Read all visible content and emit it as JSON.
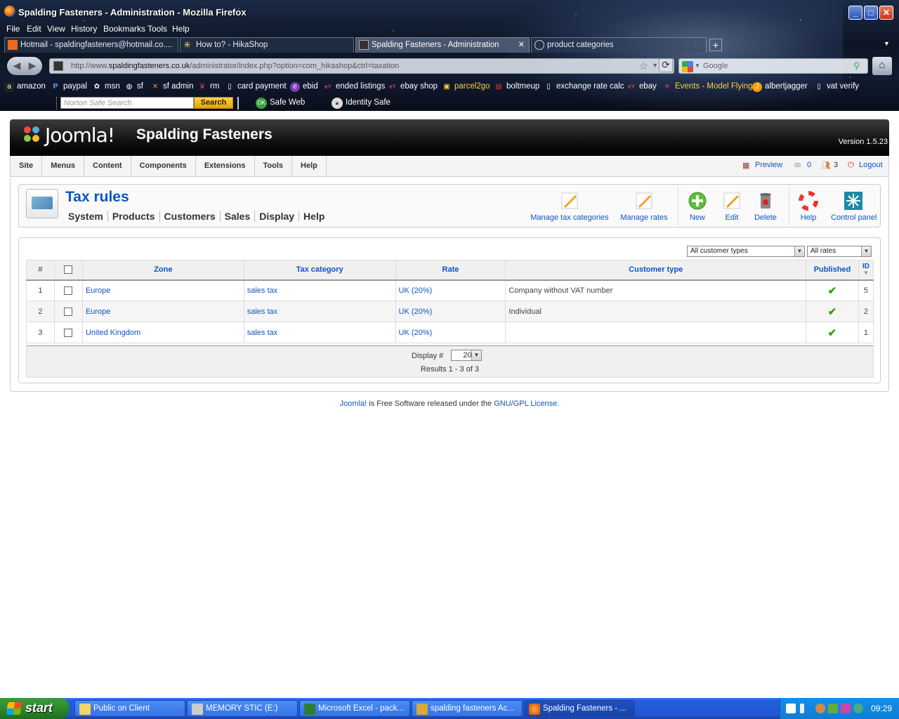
{
  "browser": {
    "window_title": "Spalding Fasteners - Administration - Mozilla Firefox",
    "menu": [
      "File",
      "Edit",
      "View",
      "History",
      "Bookmarks",
      "Tools",
      "Help"
    ],
    "tabs": [
      {
        "label": "Hotmail - spaldingfasteners@hotmail.co....",
        "active": false
      },
      {
        "label": "How to? - HikaShop",
        "active": false
      },
      {
        "label": "Spalding Fasteners - Administration",
        "active": true
      },
      {
        "label": "product categories",
        "active": false
      }
    ],
    "url_prefix": "http://www.",
    "url_domain": "spaldingfasteners.co.uk",
    "url_rest": "/administrator/index.php?option=com_hikashop&ctrl=taxation",
    "search_engine": "Google",
    "bookmarks": [
      "amazon",
      "paypal",
      "msn",
      "sf",
      "sf admin",
      "rm",
      "card payment",
      "ebid",
      "ended listings",
      "ebay shop",
      "parcel2go",
      "boltmeup",
      "exchange rate calc",
      "ebay",
      "Events - Model Flying",
      "albertjagger",
      "vat verify"
    ],
    "norton": {
      "search_placeholder": "Norton Safe Search",
      "search_button": "Search",
      "safe_web": "Safe Web",
      "identity_safe": "Identity Safe"
    }
  },
  "joomla": {
    "logo_text": "Joomla!",
    "site_name": "Spalding Fasteners",
    "version": "Version 1.5.23",
    "menu": [
      "Site",
      "Menus",
      "Content",
      "Components",
      "Extensions",
      "Tools",
      "Help"
    ],
    "status": {
      "preview": "Preview",
      "messages": "0",
      "users": "3",
      "logout": "Logout"
    },
    "page_title": "Tax rules",
    "submenu": [
      "System",
      "Products",
      "Customers",
      "Sales",
      "Display",
      "Help"
    ],
    "toolbar": {
      "manage_tax_categories": "Manage tax categories",
      "manage_rates": "Manage rates",
      "new": "New",
      "edit": "Edit",
      "delete": "Delete",
      "help": "Help",
      "control_panel": "Control panel"
    },
    "filters": {
      "customer_types": "All customer types",
      "rates": "All rates"
    },
    "table": {
      "headers": {
        "num": "#",
        "zone": "Zone",
        "tax_category": "Tax category",
        "rate": "Rate",
        "customer_type": "Customer type",
        "published": "Published",
        "id": "ID"
      },
      "rows": [
        {
          "num": "1",
          "zone": "Europe",
          "tax_category": "sales tax",
          "rate": "UK (20%)",
          "customer_type": "Company without VAT number",
          "published": true,
          "id": "5"
        },
        {
          "num": "2",
          "zone": "Europe",
          "tax_category": "sales tax",
          "rate": "UK (20%)",
          "customer_type": "Individual",
          "published": true,
          "id": "2"
        },
        {
          "num": "3",
          "zone": "United Kingdom",
          "tax_category": "sales tax",
          "rate": "UK (20%)",
          "customer_type": "",
          "published": true,
          "id": "1"
        }
      ]
    },
    "pagination": {
      "display_label": "Display #",
      "display_value": "20",
      "results": "Results 1 - 3 of 3"
    },
    "footer": {
      "joomla_link": "Joomla!",
      "middle": " is Free Software released under the ",
      "license_link": "GNU/GPL License",
      "end": "."
    }
  },
  "taskbar": {
    "start": "start",
    "tasks": [
      {
        "label": "Public on Client",
        "active": false
      },
      {
        "label": "MEMORY STIC (E:)",
        "active": false
      },
      {
        "label": "Microsoft Excel - pack...",
        "active": false
      },
      {
        "label": "spalding fasteners Ac...",
        "active": false
      },
      {
        "label": "Spalding Fasteners - ...",
        "active": true
      }
    ],
    "clock": "09:29"
  },
  "colors": {
    "link": "#0b55c4",
    "joomla_green": "#8ec53f",
    "published_check": "#3a9a1a"
  }
}
